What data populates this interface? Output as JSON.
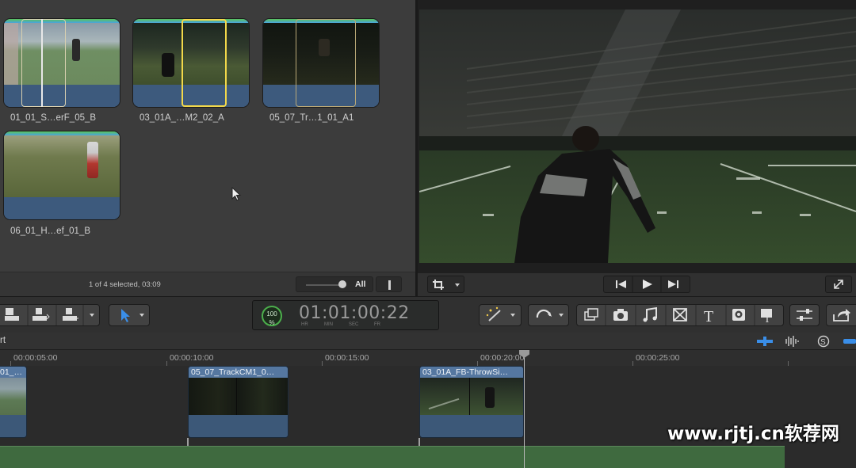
{
  "browser": {
    "clips": [
      {
        "name": "01_01_S…erF_05_B"
      },
      {
        "name": "03_01A_…M2_02_A"
      },
      {
        "name": "05_07_Tr…1_01_A1"
      },
      {
        "name": "06_01_H…ef_01_B"
      }
    ],
    "status": "1 of 4 selected, 03:09",
    "zoom_label": "All"
  },
  "toolbar": {
    "timecode": "01:01:00:22",
    "timecode_units": [
      "HR",
      "MIN",
      "SEC",
      "FR"
    ],
    "badge_value": "100",
    "badge_unit": "%"
  },
  "timeline": {
    "project_label": "rt",
    "ruler": [
      "00:00:05:00",
      "00:00:10:00",
      "00:00:15:00",
      "00:00:20:00",
      "00:00:25:00"
    ],
    "clips": [
      {
        "title": "01_…"
      },
      {
        "title": "05_07_TrackCM1_0…"
      },
      {
        "title": "03_01A_FB-ThrowSi…"
      }
    ]
  },
  "watermark": "www.rjtj.cn软荐网",
  "colors": {
    "clip_blue": "#3e5a7c",
    "clip_title": "#5577a0",
    "selection_yellow": "#f2d84a",
    "audio_green": "#3f6a3f",
    "timecode_badge": "#4caf4c"
  }
}
